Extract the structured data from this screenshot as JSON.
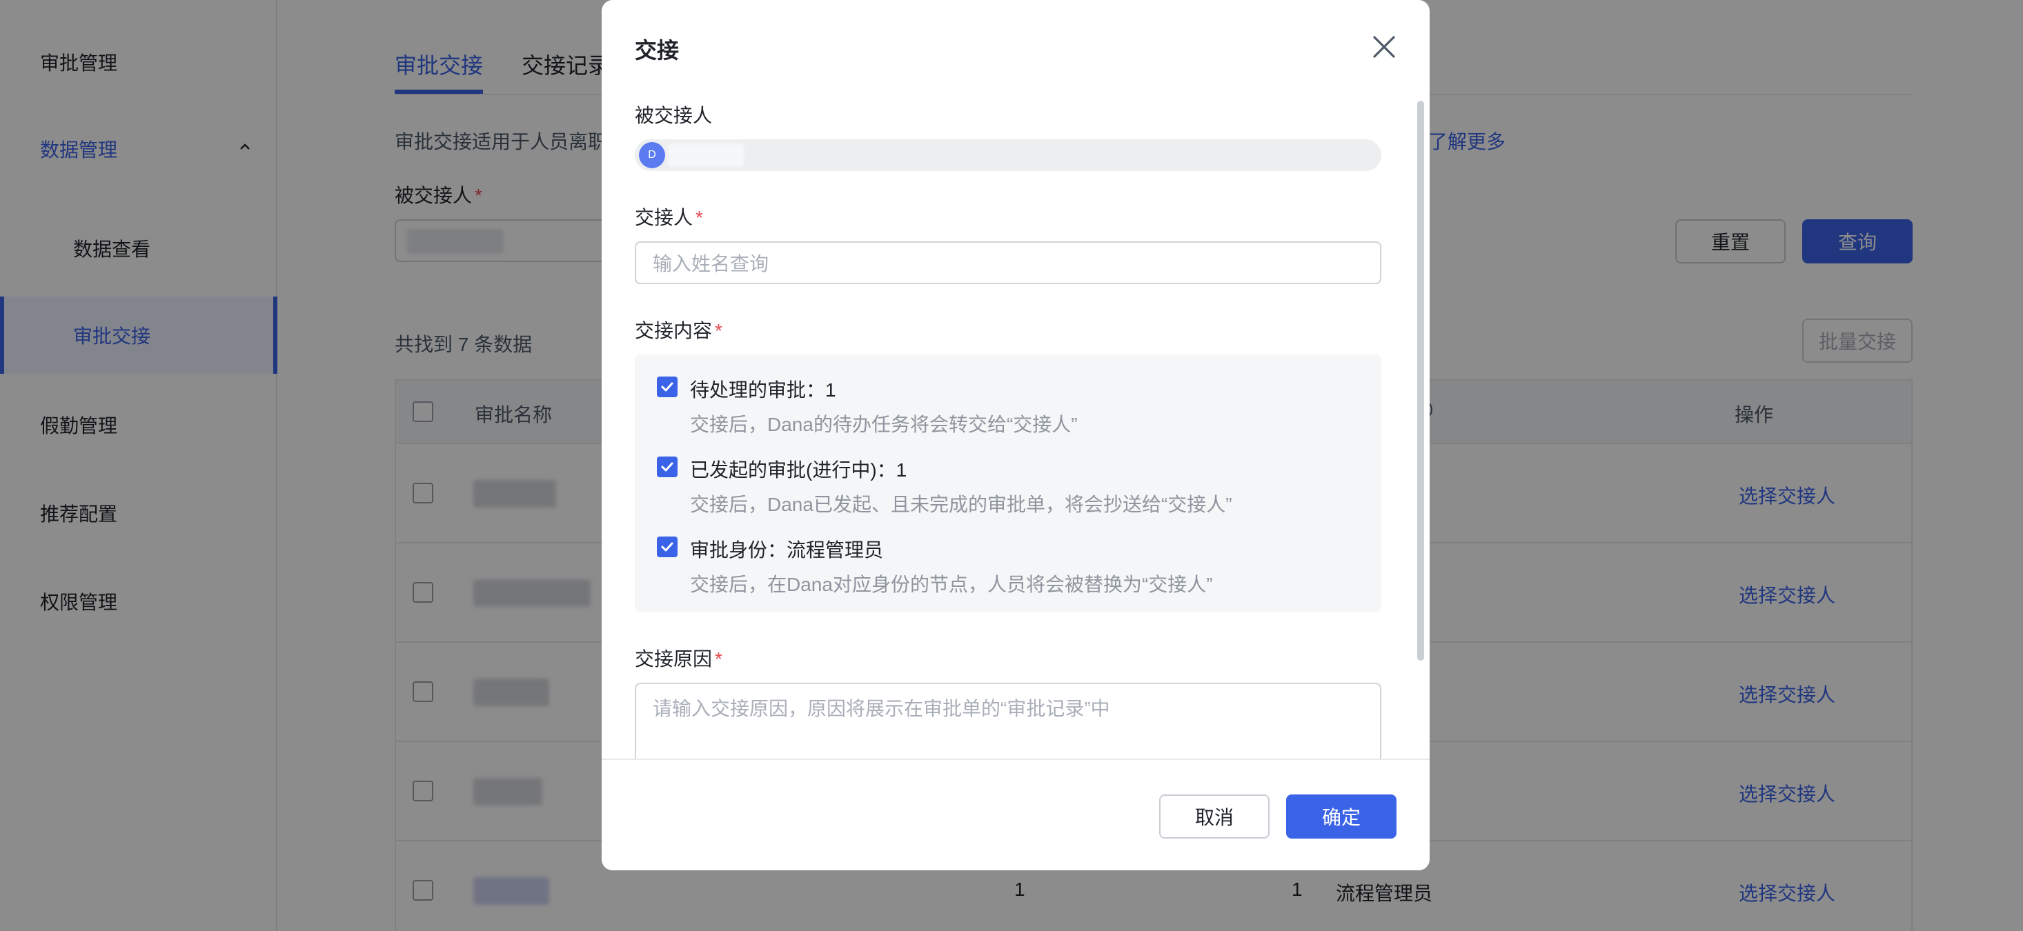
{
  "sidebar": {
    "items": [
      {
        "label": "审批管理"
      },
      {
        "label": "数据管理"
      },
      {
        "label": "数据查看"
      },
      {
        "label": "审批交接"
      },
      {
        "label": "假勤管理"
      },
      {
        "label": "推荐配置"
      },
      {
        "label": "权限管理"
      }
    ]
  },
  "main": {
    "tabs": [
      {
        "label": "审批交接",
        "active": true
      },
      {
        "label": "交接记录"
      }
    ],
    "info_text": "审批交接适用于人员离职",
    "learn_more": "了解更多",
    "handover_from_label": "被交接人",
    "reset_label": "重置",
    "query_label": "查询",
    "count_text": "共找到 7 条数据",
    "batch_label": "批量交接",
    "table": {
      "columns": [
        "审批名称",
        "操作"
      ],
      "rows": [
        {
          "action": "选择交接人"
        },
        {
          "action": "选择交接人"
        },
        {
          "action": "选择交接人"
        },
        {
          "action": "选择交接人"
        },
        {
          "c1": "1",
          "c2": "1",
          "c3": "流程管理员",
          "action": "选择交接人"
        }
      ]
    }
  },
  "modal": {
    "title": "交接",
    "handover_from_label": "被交接人",
    "avatar_initial": "D",
    "handover_to_label": "交接人",
    "handover_to_placeholder": "输入姓名查询",
    "content_label": "交接内容",
    "items": [
      {
        "label": "待处理的审批：1",
        "desc": "交接后，Dana的待办任务将会转交给“交接人”",
        "checked": true
      },
      {
        "label": "已发起的审批(进行中)：1",
        "desc": "交接后，Dana已发起、且未完成的审批单，将会抄送给“交接人”",
        "checked": true
      },
      {
        "label": "审批身份：流程管理员",
        "desc": "交接后，在Dana对应身份的节点，人员将会被替换为“交接人”",
        "checked": true
      }
    ],
    "reason_label": "交接原因",
    "reason_placeholder": "请输入交接原因，原因将展示在审批单的“审批记录”中",
    "required_mark": "*",
    "cancel_label": "取消",
    "ok_label": "确定"
  },
  "colors": {
    "accent": "#3b63e8",
    "required": "#e5484d",
    "mask": "rgba(0,0,0,0.45)"
  }
}
